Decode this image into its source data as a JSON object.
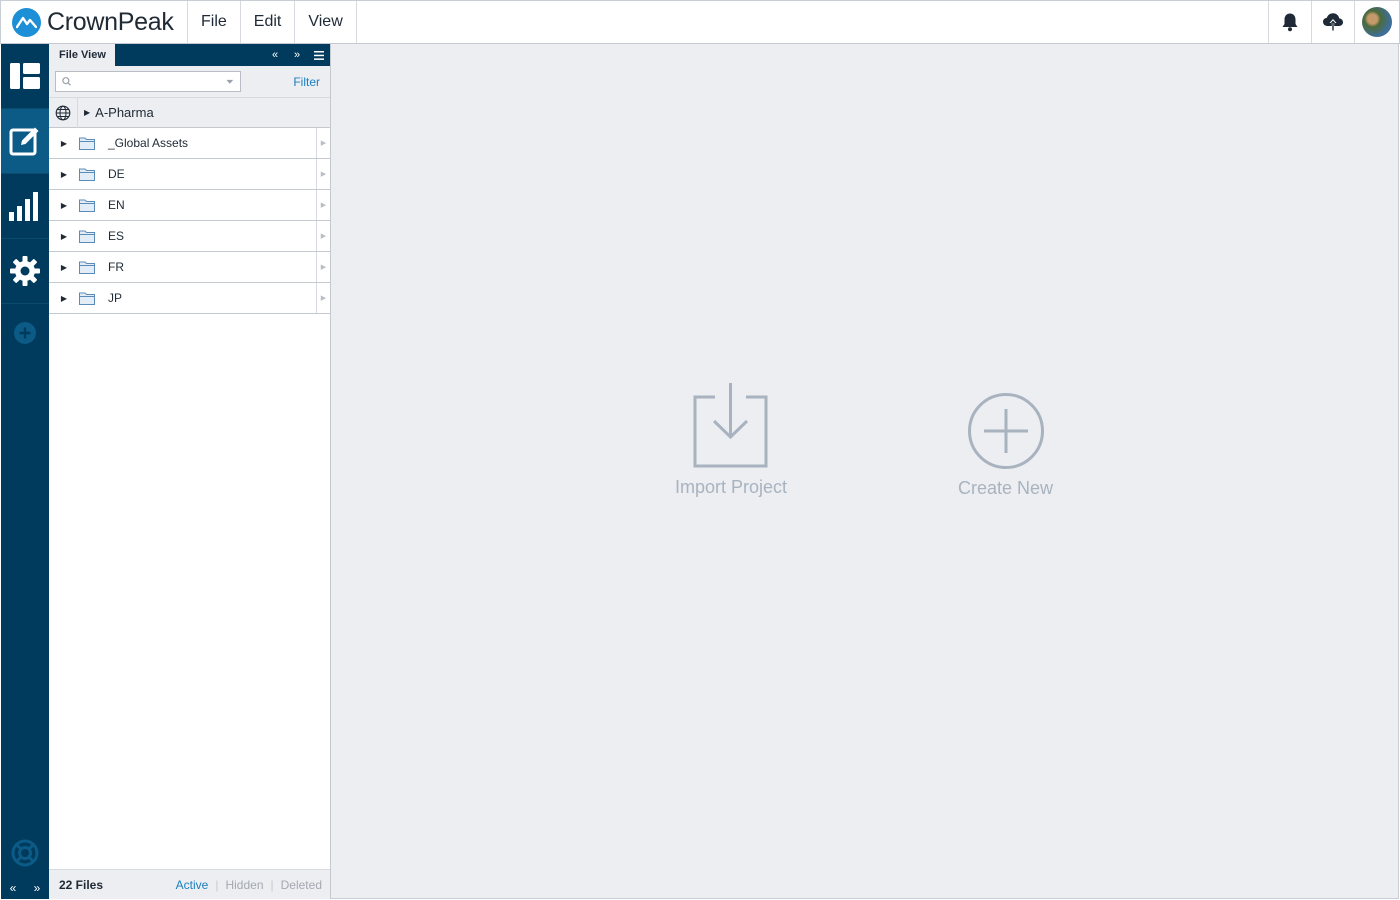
{
  "app": {
    "brand": "CrownPeak"
  },
  "menu": {
    "items": [
      "File",
      "Edit",
      "View"
    ]
  },
  "top_icons": [
    "bell-icon",
    "cloud-upload-icon",
    "user-avatar"
  ],
  "leftnav": {
    "items": [
      "dashboard-icon",
      "edit-icon",
      "reports-icon",
      "settings-icon",
      "add-icon"
    ],
    "active": "edit-icon"
  },
  "panel": {
    "tab_label": "File View",
    "search": {
      "value": "",
      "placeholder": ""
    },
    "filter_label": "Filter",
    "root": {
      "label": "A-Pharma"
    },
    "folders": [
      {
        "label": "_Global Assets"
      },
      {
        "label": "DE"
      },
      {
        "label": "EN"
      },
      {
        "label": "ES"
      },
      {
        "label": "FR"
      },
      {
        "label": "JP"
      }
    ],
    "footer": {
      "count": "22 Files",
      "active": "Active",
      "hidden": "Hidden",
      "deleted": "Deleted"
    }
  },
  "main": {
    "import_label": "Import Project",
    "create_label": "Create New"
  },
  "colors": {
    "nav_bg": "#003a5c",
    "nav_active": "#0c5a86",
    "accent": "#1a7fc0",
    "main_bg": "#eceef2",
    "muted_icon": "#a9b3bf"
  }
}
